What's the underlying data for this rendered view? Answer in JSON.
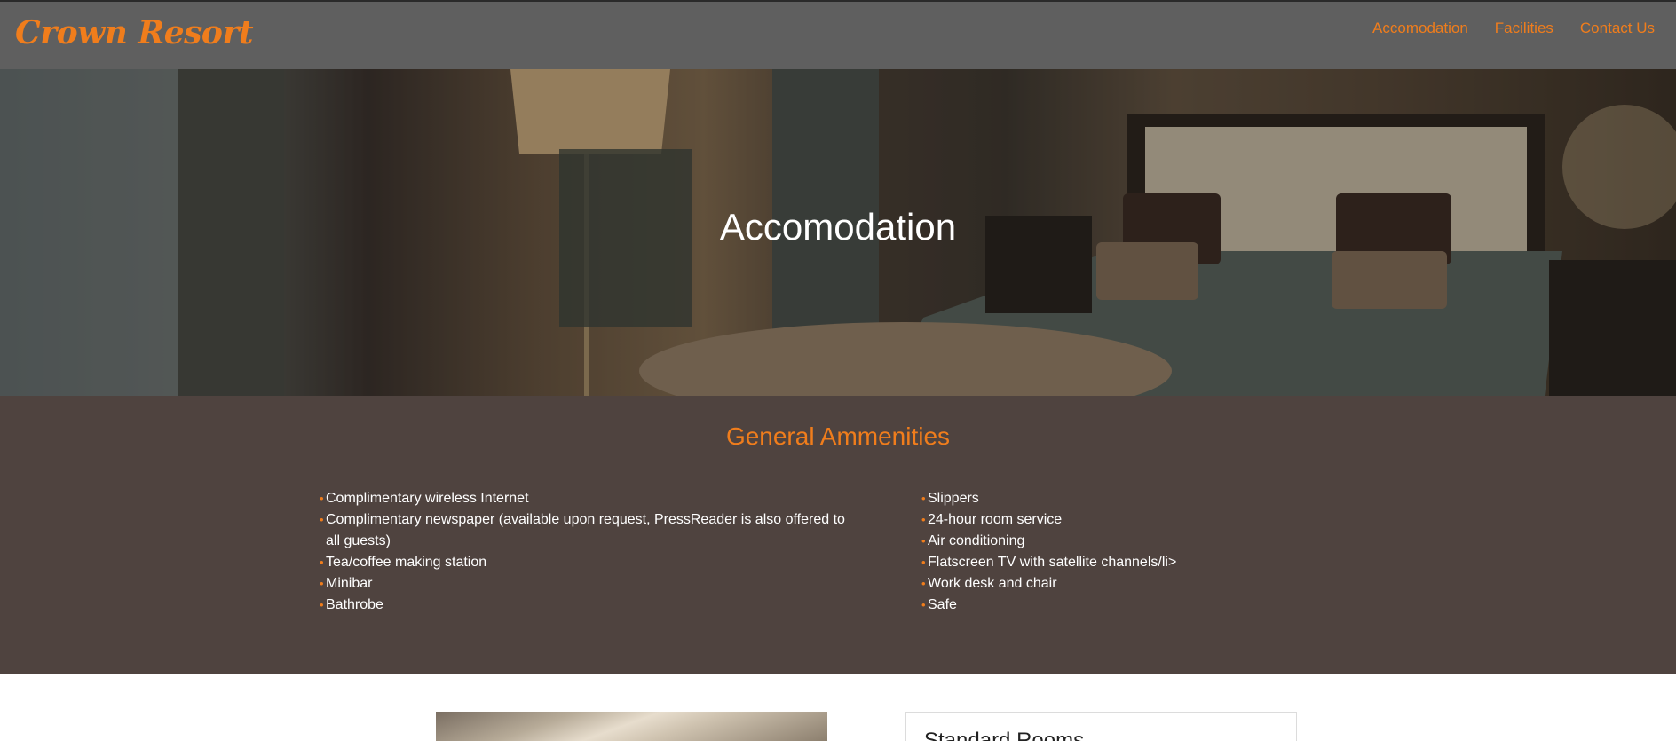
{
  "brand": "Crown Resort",
  "nav": [
    "Accomodation",
    "Facilities",
    "Contact Us"
  ],
  "hero": {
    "title": "Accomodation"
  },
  "amenities": {
    "title": "General Ammenities",
    "left": [
      "Complimentary wireless Internet",
      "Complimentary newspaper (available upon request, PressReader is also offered to all guests)",
      "Tea/coffee making station",
      "Minibar",
      "Bathrobe"
    ],
    "right": [
      "Slippers",
      "24-hour room service",
      "Air conditioning",
      "Flatscreen TV with satellite channels/li>",
      "Work desk and chair",
      "Safe"
    ]
  },
  "rooms": {
    "first_title": "Standard Rooms"
  },
  "colors": {
    "accent": "#f07d1c",
    "nav_bg": "#5f5f5f",
    "amenities_bg": "#4f433f"
  }
}
